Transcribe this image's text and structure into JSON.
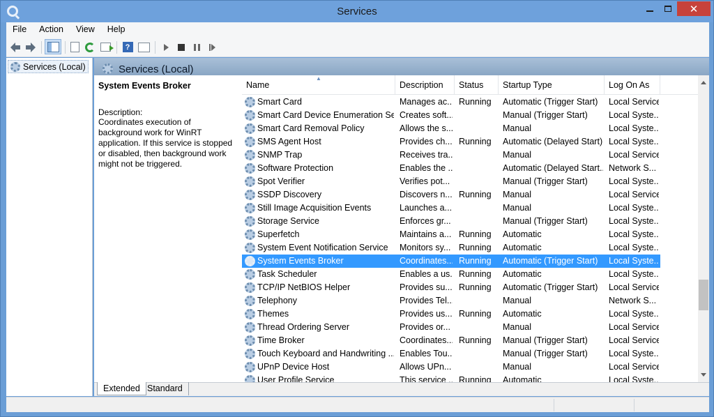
{
  "window": {
    "title": "Services"
  },
  "menu": [
    "File",
    "Action",
    "View",
    "Help"
  ],
  "toolbar": {
    "icons": [
      "back-arrow-icon",
      "forward-arrow-icon",
      "show-hide-tree-icon",
      "export-list-icon",
      "refresh-icon",
      "export-icon",
      "help-icon",
      "properties-icon",
      "start-service-icon",
      "stop-service-icon",
      "pause-service-icon",
      "restart-service-icon"
    ]
  },
  "tree": {
    "root_label": "Services (Local)"
  },
  "pane": {
    "title": "Services (Local)"
  },
  "details": {
    "service_name": "System Events Broker",
    "description_label": "Description:",
    "description": "Coordinates execution of background work for WinRT application. If this service is stopped or disabled, then background work might not be triggered."
  },
  "columns": [
    "Name",
    "Description",
    "Status",
    "Startup Type",
    "Log On As"
  ],
  "services": [
    {
      "name": "Smart Card",
      "description": "Manages ac...",
      "status": "Running",
      "startup": "Automatic (Trigger Start)",
      "logon": "Local Service",
      "selected": false
    },
    {
      "name": "Smart Card Device Enumeration Ser...",
      "description": "Creates soft...",
      "status": "",
      "startup": "Manual (Trigger Start)",
      "logon": "Local Syste...",
      "selected": false
    },
    {
      "name": "Smart Card Removal Policy",
      "description": "Allows the s...",
      "status": "",
      "startup": "Manual",
      "logon": "Local Syste...",
      "selected": false
    },
    {
      "name": "SMS Agent Host",
      "description": "Provides ch...",
      "status": "Running",
      "startup": "Automatic (Delayed Start)",
      "logon": "Local Syste...",
      "selected": false
    },
    {
      "name": "SNMP Trap",
      "description": "Receives tra...",
      "status": "",
      "startup": "Manual",
      "logon": "Local Service",
      "selected": false
    },
    {
      "name": "Software Protection",
      "description": "Enables the ...",
      "status": "",
      "startup": "Automatic (Delayed Start...",
      "logon": "Network S...",
      "selected": false
    },
    {
      "name": "Spot Verifier",
      "description": "Verifies pot...",
      "status": "",
      "startup": "Manual (Trigger Start)",
      "logon": "Local Syste...",
      "selected": false
    },
    {
      "name": "SSDP Discovery",
      "description": "Discovers n...",
      "status": "Running",
      "startup": "Manual",
      "logon": "Local Service",
      "selected": false
    },
    {
      "name": "Still Image Acquisition Events",
      "description": "Launches a...",
      "status": "",
      "startup": "Manual",
      "logon": "Local Syste...",
      "selected": false
    },
    {
      "name": "Storage Service",
      "description": "Enforces gr...",
      "status": "",
      "startup": "Manual (Trigger Start)",
      "logon": "Local Syste...",
      "selected": false
    },
    {
      "name": "Superfetch",
      "description": "Maintains a...",
      "status": "Running",
      "startup": "Automatic",
      "logon": "Local Syste...",
      "selected": false
    },
    {
      "name": "System Event Notification Service",
      "description": "Monitors sy...",
      "status": "Running",
      "startup": "Automatic",
      "logon": "Local Syste...",
      "selected": false
    },
    {
      "name": "System Events Broker",
      "description": "Coordinates...",
      "status": "Running",
      "startup": "Automatic (Trigger Start)",
      "logon": "Local Syste...",
      "selected": true
    },
    {
      "name": "Task Scheduler",
      "description": "Enables a us...",
      "status": "Running",
      "startup": "Automatic",
      "logon": "Local Syste...",
      "selected": false
    },
    {
      "name": "TCP/IP NetBIOS Helper",
      "description": "Provides su...",
      "status": "Running",
      "startup": "Automatic (Trigger Start)",
      "logon": "Local Service",
      "selected": false
    },
    {
      "name": "Telephony",
      "description": "Provides Tel...",
      "status": "",
      "startup": "Manual",
      "logon": "Network S...",
      "selected": false
    },
    {
      "name": "Themes",
      "description": "Provides us...",
      "status": "Running",
      "startup": "Automatic",
      "logon": "Local Syste...",
      "selected": false
    },
    {
      "name": "Thread Ordering Server",
      "description": "Provides or...",
      "status": "",
      "startup": "Manual",
      "logon": "Local Service",
      "selected": false
    },
    {
      "name": "Time Broker",
      "description": "Coordinates...",
      "status": "Running",
      "startup": "Manual (Trigger Start)",
      "logon": "Local Service",
      "selected": false
    },
    {
      "name": "Touch Keyboard and Handwriting ...",
      "description": "Enables Tou...",
      "status": "",
      "startup": "Manual (Trigger Start)",
      "logon": "Local Syste...",
      "selected": false
    },
    {
      "name": "UPnP Device Host",
      "description": "Allows UPn...",
      "status": "",
      "startup": "Manual",
      "logon": "Local Service",
      "selected": false
    },
    {
      "name": "User Profile Service",
      "description": "This service ...",
      "status": "Running",
      "startup": "Automatic",
      "logon": "Local Syste...",
      "selected": false
    }
  ],
  "tabs": [
    "Extended",
    "Standard"
  ],
  "colors": {
    "selection": "#3399ff",
    "close_button": "#c7423b",
    "titlebar": "#6ea1dc"
  }
}
